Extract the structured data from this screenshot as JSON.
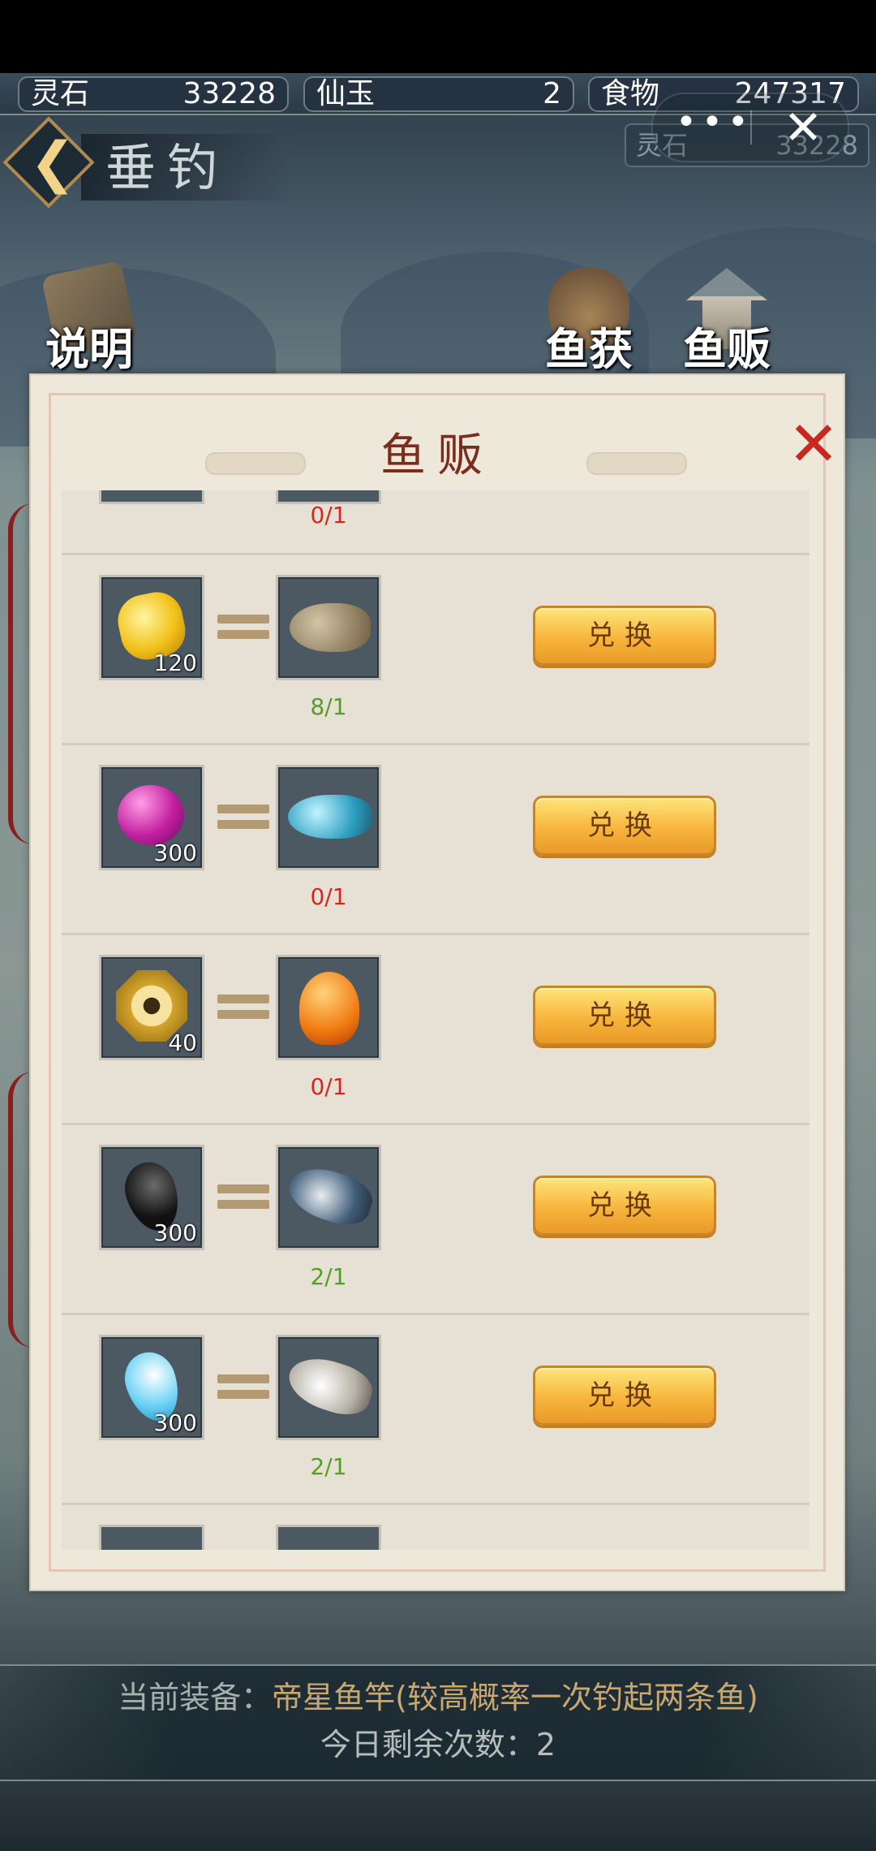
{
  "resources": [
    {
      "label": "灵石",
      "value": "33228"
    },
    {
      "label": "仙玉",
      "value": "2"
    },
    {
      "label": "食物",
      "value": "247317"
    }
  ],
  "shadow_chip": {
    "label": "灵石",
    "value": "33228"
  },
  "miniprogram": {
    "more_glyph": "•••",
    "close_glyph": "✕"
  },
  "page": {
    "back_glyph": "❮",
    "title": "垂钓"
  },
  "top_icons": [
    {
      "label": "说明",
      "icon": "scroll-book-icon"
    },
    {
      "label": "鱼获",
      "icon": "fish-bag-icon"
    },
    {
      "label": "鱼贩",
      "icon": "fisherman-icon"
    }
  ],
  "dialog": {
    "title": "鱼贩",
    "close_glyph": "✕",
    "top_partial_progress": "0/1",
    "rows": [
      {
        "item_icon": "golden-swastika-coin-icon",
        "item_qty": "120",
        "fish_icon": "carp-fish-icon",
        "progress": "8/1",
        "progress_color": "#52a022",
        "button": "兑换"
      },
      {
        "item_icon": "purple-pearl-icon",
        "item_qty": "300",
        "fish_icon": "blue-fish-icon",
        "progress": "0/1",
        "progress_color": "#d9261c",
        "button": "兑换"
      },
      {
        "item_icon": "bagua-plate-icon",
        "item_qty": "40",
        "fish_icon": "goldfish-icon",
        "progress": "0/1",
        "progress_color": "#d9261c",
        "button": "兑换"
      },
      {
        "item_icon": "black-yin-jade-icon",
        "item_qty": "300",
        "fish_icon": "bass-fish-icon",
        "progress": "2/1",
        "progress_color": "#52a022",
        "button": "兑换"
      },
      {
        "item_icon": "blue-yang-jade-icon",
        "item_qty": "300",
        "fish_icon": "white-perch-icon",
        "progress": "2/1",
        "progress_color": "#52a022",
        "button": "兑换"
      }
    ]
  },
  "footer": {
    "equip_label": "当前装备：",
    "equip_value": "帝星鱼竿(较高概率一次钓起两条鱼)",
    "remaining": "今日剩余次数：2"
  },
  "colors": {
    "equip_label": "#a7b0ad",
    "equip_value": "#c9a770",
    "dialog_title": "#7a2d1f"
  }
}
